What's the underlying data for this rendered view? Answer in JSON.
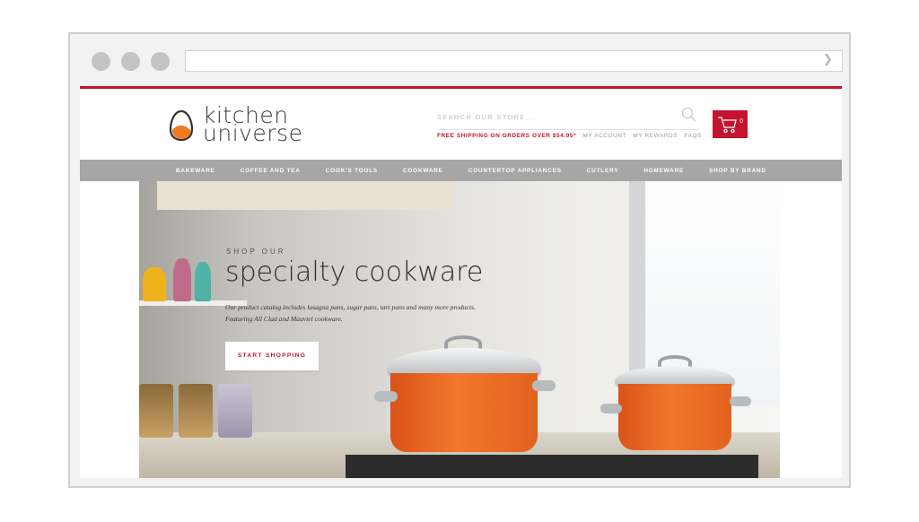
{
  "browser": {
    "url": ""
  },
  "brand": {
    "name_line1": "kitchen",
    "name_line2": "universe",
    "accent_color": "#c4122f"
  },
  "header": {
    "search_placeholder": "SEARCH OUR STORE...",
    "free_shipping": "FREE SHIPPING ON ORDERS OVER $54.95*",
    "links": [
      "MY ACCOUNT",
      "MY REWARDS",
      "FAQS"
    ],
    "cart_count": "0"
  },
  "nav": {
    "items": [
      "BAKEWARE",
      "COFFEE AND TEA",
      "COOK'S TOOLS",
      "COOKWARE",
      "COUNTERTOP APPLIANCES",
      "CUTLERY",
      "HOMEWARE",
      "SHOP BY BRAND"
    ]
  },
  "hero": {
    "kicker": "SHOP OUR",
    "title": "specialty cookware",
    "description": "Our product catalog includes lasagna pans, sugar pans, tart pans and many more products.  Featuring All Clad and Mauviel cookware.",
    "button": "START SHOPPING"
  },
  "icons": [
    "egg-logo-icon",
    "search-icon",
    "cart-icon",
    "forward-arrow-icon"
  ]
}
